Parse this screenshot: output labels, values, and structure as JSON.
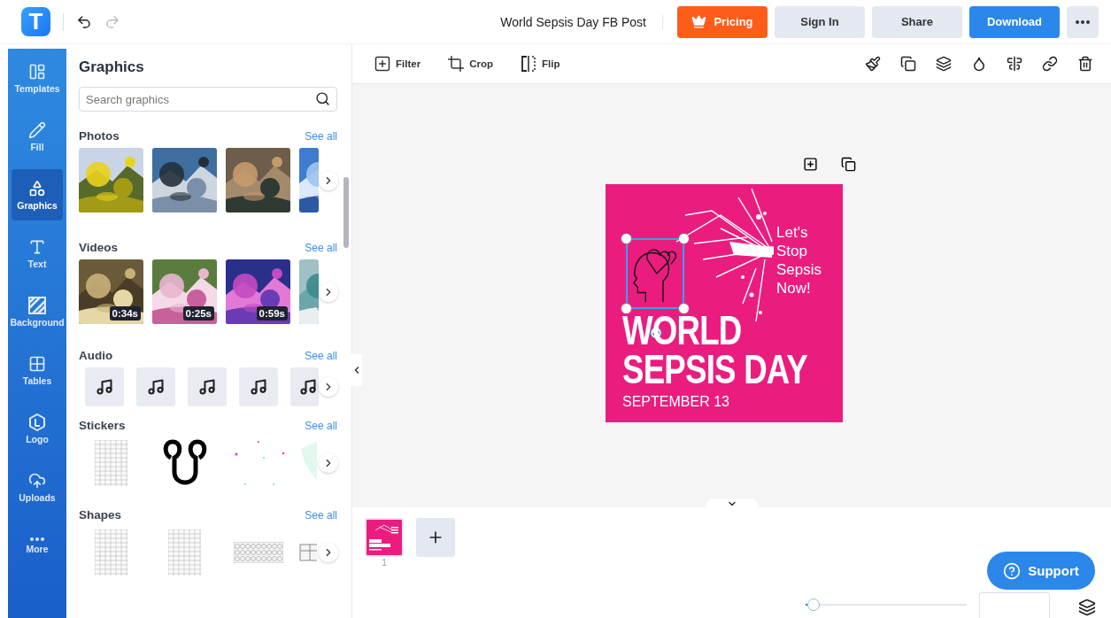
{
  "header": {
    "logo": "T",
    "title": "World Sepsis Day FB Post",
    "buttons": [
      {
        "label": "Pricing",
        "kind": "pricing"
      },
      {
        "label": "Sign In",
        "kind": "secondary"
      },
      {
        "label": "Share",
        "kind": "secondary"
      },
      {
        "label": "Download",
        "kind": "primary"
      },
      {
        "kind": "more"
      }
    ]
  },
  "rail": [
    {
      "label": "Templates",
      "selected": false
    },
    {
      "label": "Fill",
      "selected": false
    },
    {
      "label": "Graphics",
      "selected": true
    },
    {
      "label": "Text",
      "selected": false
    },
    {
      "label": "Background",
      "selected": false
    },
    {
      "label": "Tables",
      "selected": false
    },
    {
      "label": "Logo",
      "selected": false
    },
    {
      "label": "Uploads",
      "selected": false
    },
    {
      "label": "More",
      "selected": false
    }
  ],
  "panel": {
    "title": "Graphics",
    "search": {
      "placeholder": "Search graphics"
    },
    "sections": [
      {
        "title": "Photos",
        "see_all": "See all",
        "kind": "photos",
        "items": [
          {
            "kind": "picture"
          },
          {
            "kind": "picture"
          },
          {
            "kind": "picture"
          },
          {
            "kind": "picture"
          }
        ]
      },
      {
        "title": "Videos",
        "see_all": "See all",
        "kind": "videos",
        "items": [
          {
            "kind": "picture",
            "duration": "0:34s"
          },
          {
            "kind": "picture",
            "duration": "0:25s"
          },
          {
            "kind": "picture",
            "duration": "0:59s"
          },
          {
            "kind": "picture"
          }
        ]
      },
      {
        "title": "Audio",
        "see_all": "See all",
        "kind": "audio",
        "items": [
          {
            "kind": "audio"
          },
          {
            "kind": "audio"
          },
          {
            "kind": "audio"
          },
          {
            "kind": "audio"
          },
          {
            "kind": "audio"
          }
        ]
      },
      {
        "title": "Stickers",
        "see_all": "See all",
        "kind": "stickers",
        "items": [
          {
            "kind": "grid"
          },
          {
            "kind": "loop"
          },
          {
            "kind": "dots"
          },
          {
            "kind": "leaf"
          }
        ]
      },
      {
        "title": "Shapes",
        "see_all": "See all",
        "kind": "shapes",
        "items": [
          {
            "kind": "grid"
          },
          {
            "kind": "grid"
          },
          {
            "kind": "circles"
          },
          {
            "kind": "table"
          }
        ]
      }
    ]
  },
  "toolbar": {
    "tools": [
      {
        "label": "Filter"
      },
      {
        "label": "Crop"
      },
      {
        "label": "Flip"
      }
    ]
  },
  "design": {
    "tagline": [
      "Let's",
      "Stop",
      "Sepsis",
      "Now!"
    ],
    "headline": [
      "WORLD",
      "SEPSIS DAY"
    ],
    "date": "SEPTEMBER 13",
    "selected_graphic": true
  },
  "pages": [
    {
      "number": "1",
      "selected": true
    }
  ],
  "zoom": {
    "level": 0.05
  },
  "support": {
    "label": "Support"
  }
}
